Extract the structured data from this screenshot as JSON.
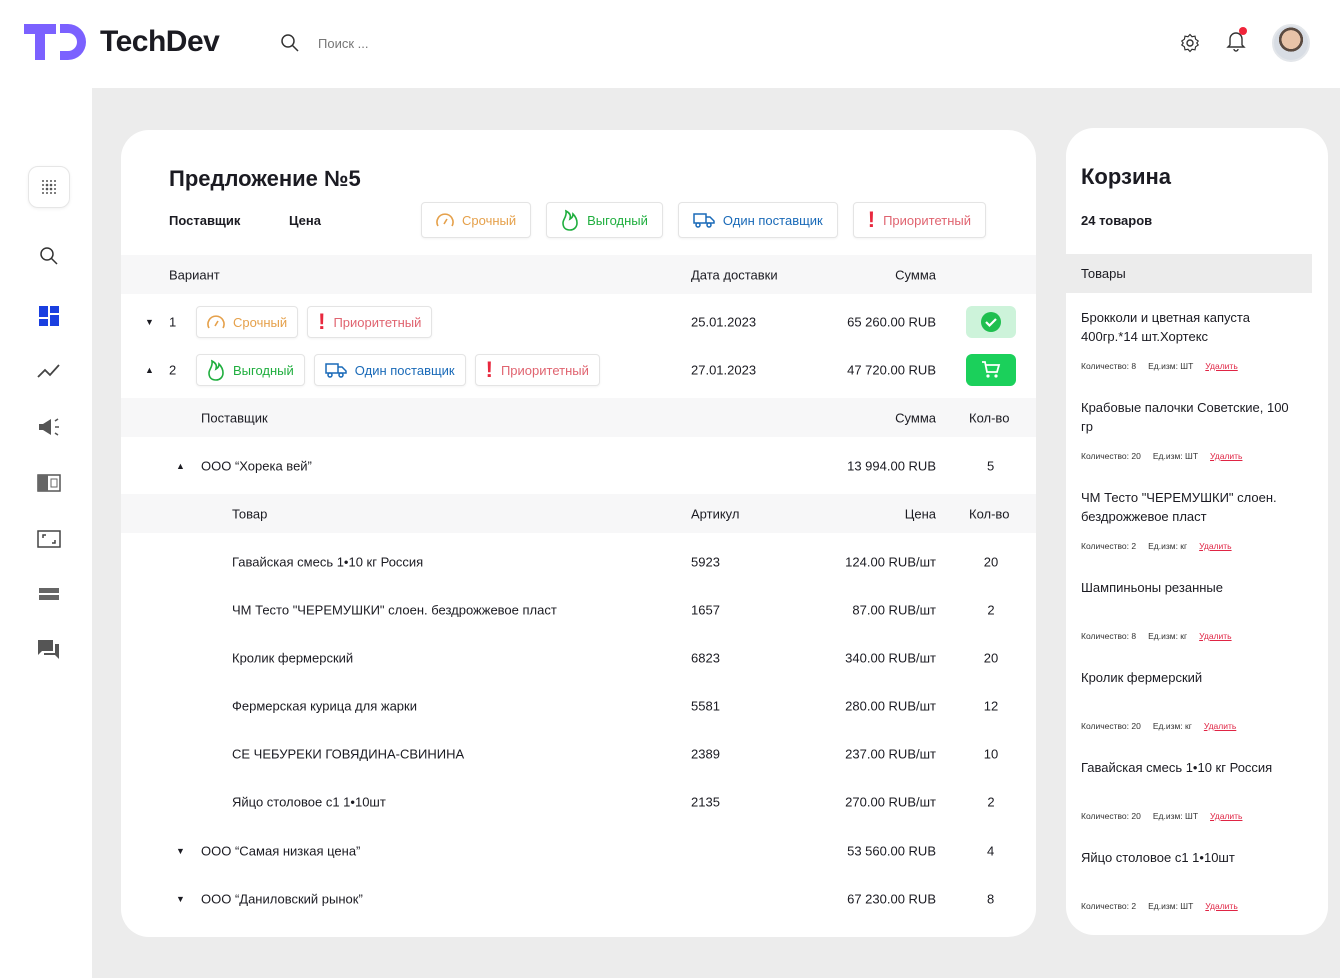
{
  "header": {
    "brand": "TechDev",
    "search_placeholder": "Поиск ..."
  },
  "offer": {
    "title": "Предложение №5",
    "filter_labels": [
      "Поставщик",
      "Цена"
    ],
    "tags": {
      "urgent": "Срочный",
      "good": "Выгодный",
      "one": "Один поставщик",
      "priority": "Приоритетный"
    },
    "columns": {
      "variant": "Вариант",
      "date": "Дата доставки",
      "sum": "Сумма"
    },
    "variants": [
      {
        "num": "1",
        "date": "25.01.2023",
        "sum": "65 260.00 RUB"
      },
      {
        "num": "2",
        "date": "27.01.2023",
        "sum": "47 720.00 RUB"
      }
    ],
    "supplier_columns": {
      "supplier": "Поставщик",
      "sum": "Сумма",
      "qty": "Кол-во"
    },
    "item_columns": {
      "product": "Товар",
      "sku": "Артикул",
      "price": "Цена",
      "qty": "Кол-во"
    },
    "suppliers": [
      {
        "name": "ООО “Хорека вей”",
        "sum": "13 994.00 RUB",
        "qty": "5"
      },
      {
        "name": "ООО “Самая низкая цена”",
        "sum": "53 560.00 RUB",
        "qty": "4"
      },
      {
        "name": "ООО “Даниловский рынок”",
        "sum": "67 230.00 RUB",
        "qty": "8"
      }
    ],
    "items": [
      {
        "name": "Гавайская смесь 1•10 кг Россия",
        "sku": "5923",
        "price": "124.00 RUB/шт",
        "qty": "20"
      },
      {
        "name": "ЧМ Тесто \"ЧЕРЕМУШКИ\" слоен. бездрожжевое пласт",
        "sku": "1657",
        "price": "87.00 RUB/шт",
        "qty": "2"
      },
      {
        "name": "Кролик фермерский",
        "sku": "6823",
        "price": "340.00 RUB/шт",
        "qty": "20"
      },
      {
        "name": "Фермерская курица для жарки",
        "sku": "5581",
        "price": "280.00 RUB/шт",
        "qty": "12"
      },
      {
        "name": "СЕ ЧЕБУРЕКИ ГОВЯДИНА-СВИНИНА",
        "sku": "2389",
        "price": "237.00 RUB/шт",
        "qty": "10"
      },
      {
        "name": "Яйцо столовое с1 1•10шт",
        "sku": "2135",
        "price": "270.00 RUB/шт",
        "qty": "2"
      }
    ]
  },
  "cart": {
    "title": "Корзина",
    "count": "24 товаров",
    "section": "Товары",
    "delete_label": "Удалить",
    "items": [
      {
        "name": "Брокколи и цветная капуста 400гр.*14 шт.Хортекс",
        "qty": "Количество: 8",
        "unit": "Ед.изм: ШТ"
      },
      {
        "name": "Крабовые палочки Советские, 100 гр",
        "qty": "Количество: 20",
        "unit": "Ед.изм: ШТ"
      },
      {
        "name": "ЧМ Тесто \"ЧЕРЕМУШКИ\" слоен. бездрожжевое пласт",
        "qty": "Количество: 2",
        "unit": "Ед.изм: кг"
      },
      {
        "name": "Шампиньоны резанные",
        "qty": "Количество: 8",
        "unit": "Ед.изм: кг"
      },
      {
        "name": "Кролик фермерский",
        "qty": "Количество: 20",
        "unit": "Ед.изм: кг"
      },
      {
        "name": "Гавайская смесь 1•10 кг Россия",
        "qty": "Количество: 20",
        "unit": "Ед.изм: ШТ"
      },
      {
        "name": "Яйцо столовое с1 1•10шт",
        "qty": "Количество: 2",
        "unit": "Ед.изм: ШТ"
      }
    ]
  },
  "colors": {
    "brand": "#7b61ff",
    "accent": "#1a3fe0",
    "success": "#1bd05b",
    "danger": "#e8283e"
  }
}
